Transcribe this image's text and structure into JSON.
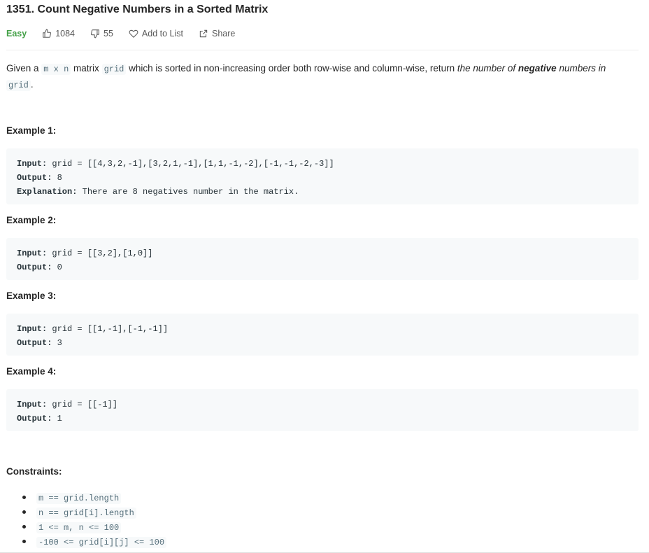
{
  "problem": {
    "title": "1351. Count Negative Numbers in a Sorted Matrix",
    "difficulty": "Easy",
    "likes": "1084",
    "dislikes": "55",
    "add_to_list": "Add to List",
    "share": "Share"
  },
  "description": {
    "p1": "Given a ",
    "c1": "m x n",
    "p2": " matrix ",
    "c2": "grid",
    "p3": " which is sorted in non-increasing order both row-wise and column-wise, return ",
    "i1": "the number of ",
    "b1": "negative",
    "i2": " numbers in",
    "c3": "grid",
    "p4": "."
  },
  "examples": [
    {
      "title": "Example 1:",
      "input_label": "Input:",
      "input": " grid = [[4,3,2,-1],[3,2,1,-1],[1,1,-1,-2],[-1,-1,-2,-3]]",
      "output_label": "Output:",
      "output": " 8",
      "explanation_label": "Explanation:",
      "explanation": " There are 8 negatives number in the matrix."
    },
    {
      "title": "Example 2:",
      "input_label": "Input:",
      "input": " grid = [[3,2],[1,0]]",
      "output_label": "Output:",
      "output": " 0"
    },
    {
      "title": "Example 3:",
      "input_label": "Input:",
      "input": " grid = [[1,-1],[-1,-1]]",
      "output_label": "Output:",
      "output": " 3"
    },
    {
      "title": "Example 4:",
      "input_label": "Input:",
      "input": " grid = [[-1]]",
      "output_label": "Output:",
      "output": " 1"
    }
  ],
  "constraints": {
    "title": "Constraints:",
    "items": [
      "m == grid.length",
      "n == grid[i].length",
      "1 <= m, n <= 100",
      "-100 <= grid[i][j] <= 100"
    ]
  }
}
